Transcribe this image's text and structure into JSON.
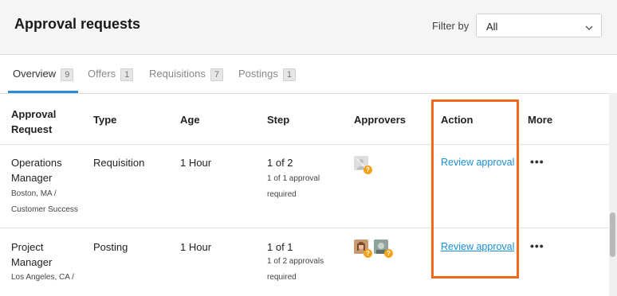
{
  "header": {
    "title": "Approval requests",
    "filter_label": "Filter by",
    "filter_value": "All"
  },
  "tabs": [
    {
      "label": "Overview",
      "count": "9"
    },
    {
      "label": "Offers",
      "count": "1"
    },
    {
      "label": "Requisitions",
      "count": "7"
    },
    {
      "label": "Postings",
      "count": "1"
    }
  ],
  "table": {
    "headers": {
      "request_line1": "Approval",
      "request_line2": "Request",
      "type": "Type",
      "age": "Age",
      "step": "Step",
      "approvers": "Approvers",
      "action": "Action",
      "more": "More"
    },
    "rows": [
      {
        "title_line1": "Operations",
        "title_line2": "Manager",
        "sub_line1": "Boston, MA /",
        "sub_line2": "Customer Success",
        "type": "Requisition",
        "age": "1 Hour",
        "step": "1 of 2",
        "step_sub1": "1 of 1 approval",
        "step_sub2": "required",
        "action": "Review approval",
        "more": "•••"
      },
      {
        "title_line1": "Project",
        "title_line2": "Manager",
        "sub_line1": "Los Angeles, CA /",
        "type": "Posting",
        "age": "1 Hour",
        "step": "1 of 1",
        "step_sub1": "1 of 2 approvals",
        "step_sub2": "required",
        "action": "Review approval",
        "more": "•••"
      }
    ]
  },
  "colors": {
    "accent": "#2b8ed8",
    "link": "#1a8fd6",
    "highlight": "#f06a1e",
    "badge": "#f5a21b"
  },
  "badge_glyph": "?"
}
